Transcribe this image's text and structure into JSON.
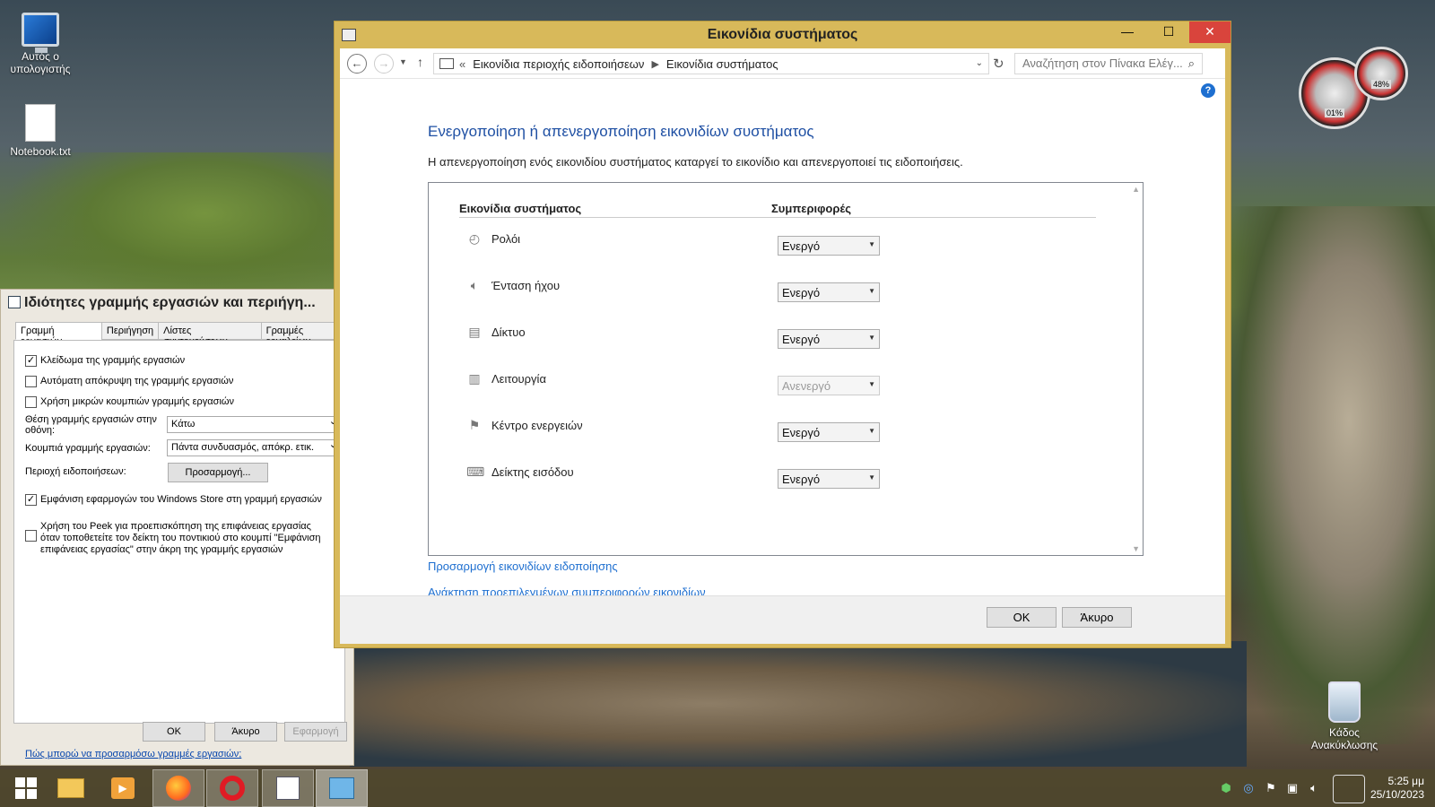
{
  "desktop": {
    "icons": [
      {
        "label": "Αυτός ο υπολογιστής",
        "icon": "computer-icon"
      },
      {
        "label": "Notebook.txt",
        "icon": "text-file-icon"
      },
      {
        "label": "Κάδος Ανακύκλωσης",
        "icon": "recycle-bin-icon"
      }
    ],
    "gauges": [
      "01%",
      "48%"
    ]
  },
  "taskbar_properties": {
    "title": "Ιδιότητες γραμμής εργασιών και περιήγη...",
    "tabs": [
      "Γραμμή εργασιών",
      "Περιήγηση",
      "Λίστες συντομεύσεων",
      "Γραμμές εργαλείων"
    ],
    "lock_label": "Κλείδωμα της γραμμής εργασιών",
    "autohide_label": "Αυτόματη απόκρυψη της γραμμής εργασιών",
    "small_buttons_label": "Χρήση μικρών κουμπιών γραμμής εργασιών",
    "position_label": "Θέση γραμμής εργασιών στην οθόνη:",
    "position_value": "Κάτω",
    "buttons_label": "Κουμπιά γραμμής εργασιών:",
    "buttons_value": "Πάντα συνδυασμός, απόκρ. ετικ.",
    "notification_label": "Περιοχή ειδοποιήσεων:",
    "customize_button": "Προσαρμογή...",
    "store_label": "Εμφάνιση εφαρμογών του Windows Store στη γραμμή εργασιών",
    "peek_label": "Χρήση του Peek για προεπισκόπηση της επιφάνειας εργασίας όταν τοποθετείτε τον δείκτη του ποντικιού στο κουμπί \"Εμφάνιση επιφάνειας εργασίας\" στην άκρη της γραμμής εργασιών",
    "help_link": "Πώς μπορώ να προσαρμόσω γραμμές εργασιών;",
    "ok": "OK",
    "cancel": "Άκυρο",
    "apply": "Εφαρμογή"
  },
  "window": {
    "title": "Εικονίδια συστήματος",
    "breadcrumb": [
      "Εικονίδια περιοχής ειδοποιήσεων",
      "Εικονίδια συστήματος"
    ],
    "breadcrumb_prefix": "«",
    "search_placeholder": "Αναζήτηση στον Πίνακα Ελέγ...",
    "heading": "Ενεργοποίηση ή απενεργοποίηση εικονιδίων συστήματος",
    "description": "Η απενεργοποίηση ενός εικονιδίου συστήματος καταργεί το εικονίδιο και απενεργοποιεί τις ειδοποιήσεις.",
    "col_icons": "Εικονίδια συστήματος",
    "col_behaviors": "Συμπεριφορές",
    "rows": [
      {
        "label": "Ρολόι",
        "value": "Ενεργό",
        "icon": "clock-icon",
        "enabled": true
      },
      {
        "label": "Ένταση ήχου",
        "value": "Ενεργό",
        "icon": "volume-icon",
        "enabled": true
      },
      {
        "label": "Δίκτυο",
        "value": "Ενεργό",
        "icon": "network-icon",
        "enabled": true
      },
      {
        "label": "Λειτουργία",
        "value": "Ανενεργό",
        "icon": "power-icon",
        "enabled": false
      },
      {
        "label": "Κέντρο ενεργειών",
        "value": "Ενεργό",
        "icon": "flag-icon",
        "enabled": true
      },
      {
        "label": "Δείκτης εισόδου",
        "value": "Ενεργό",
        "icon": "keyboard-icon",
        "enabled": true
      }
    ],
    "link_customize": "Προσαρμογή εικονιδίων ειδοποίησης",
    "link_restore": "Ανάκτηση προεπιλεγμένων συμπεριφορών εικονιδίων",
    "ok": "OK",
    "cancel": "Άκυρο"
  },
  "taskbar": {
    "time": "5:25 μμ",
    "date": "25/10/2023"
  }
}
